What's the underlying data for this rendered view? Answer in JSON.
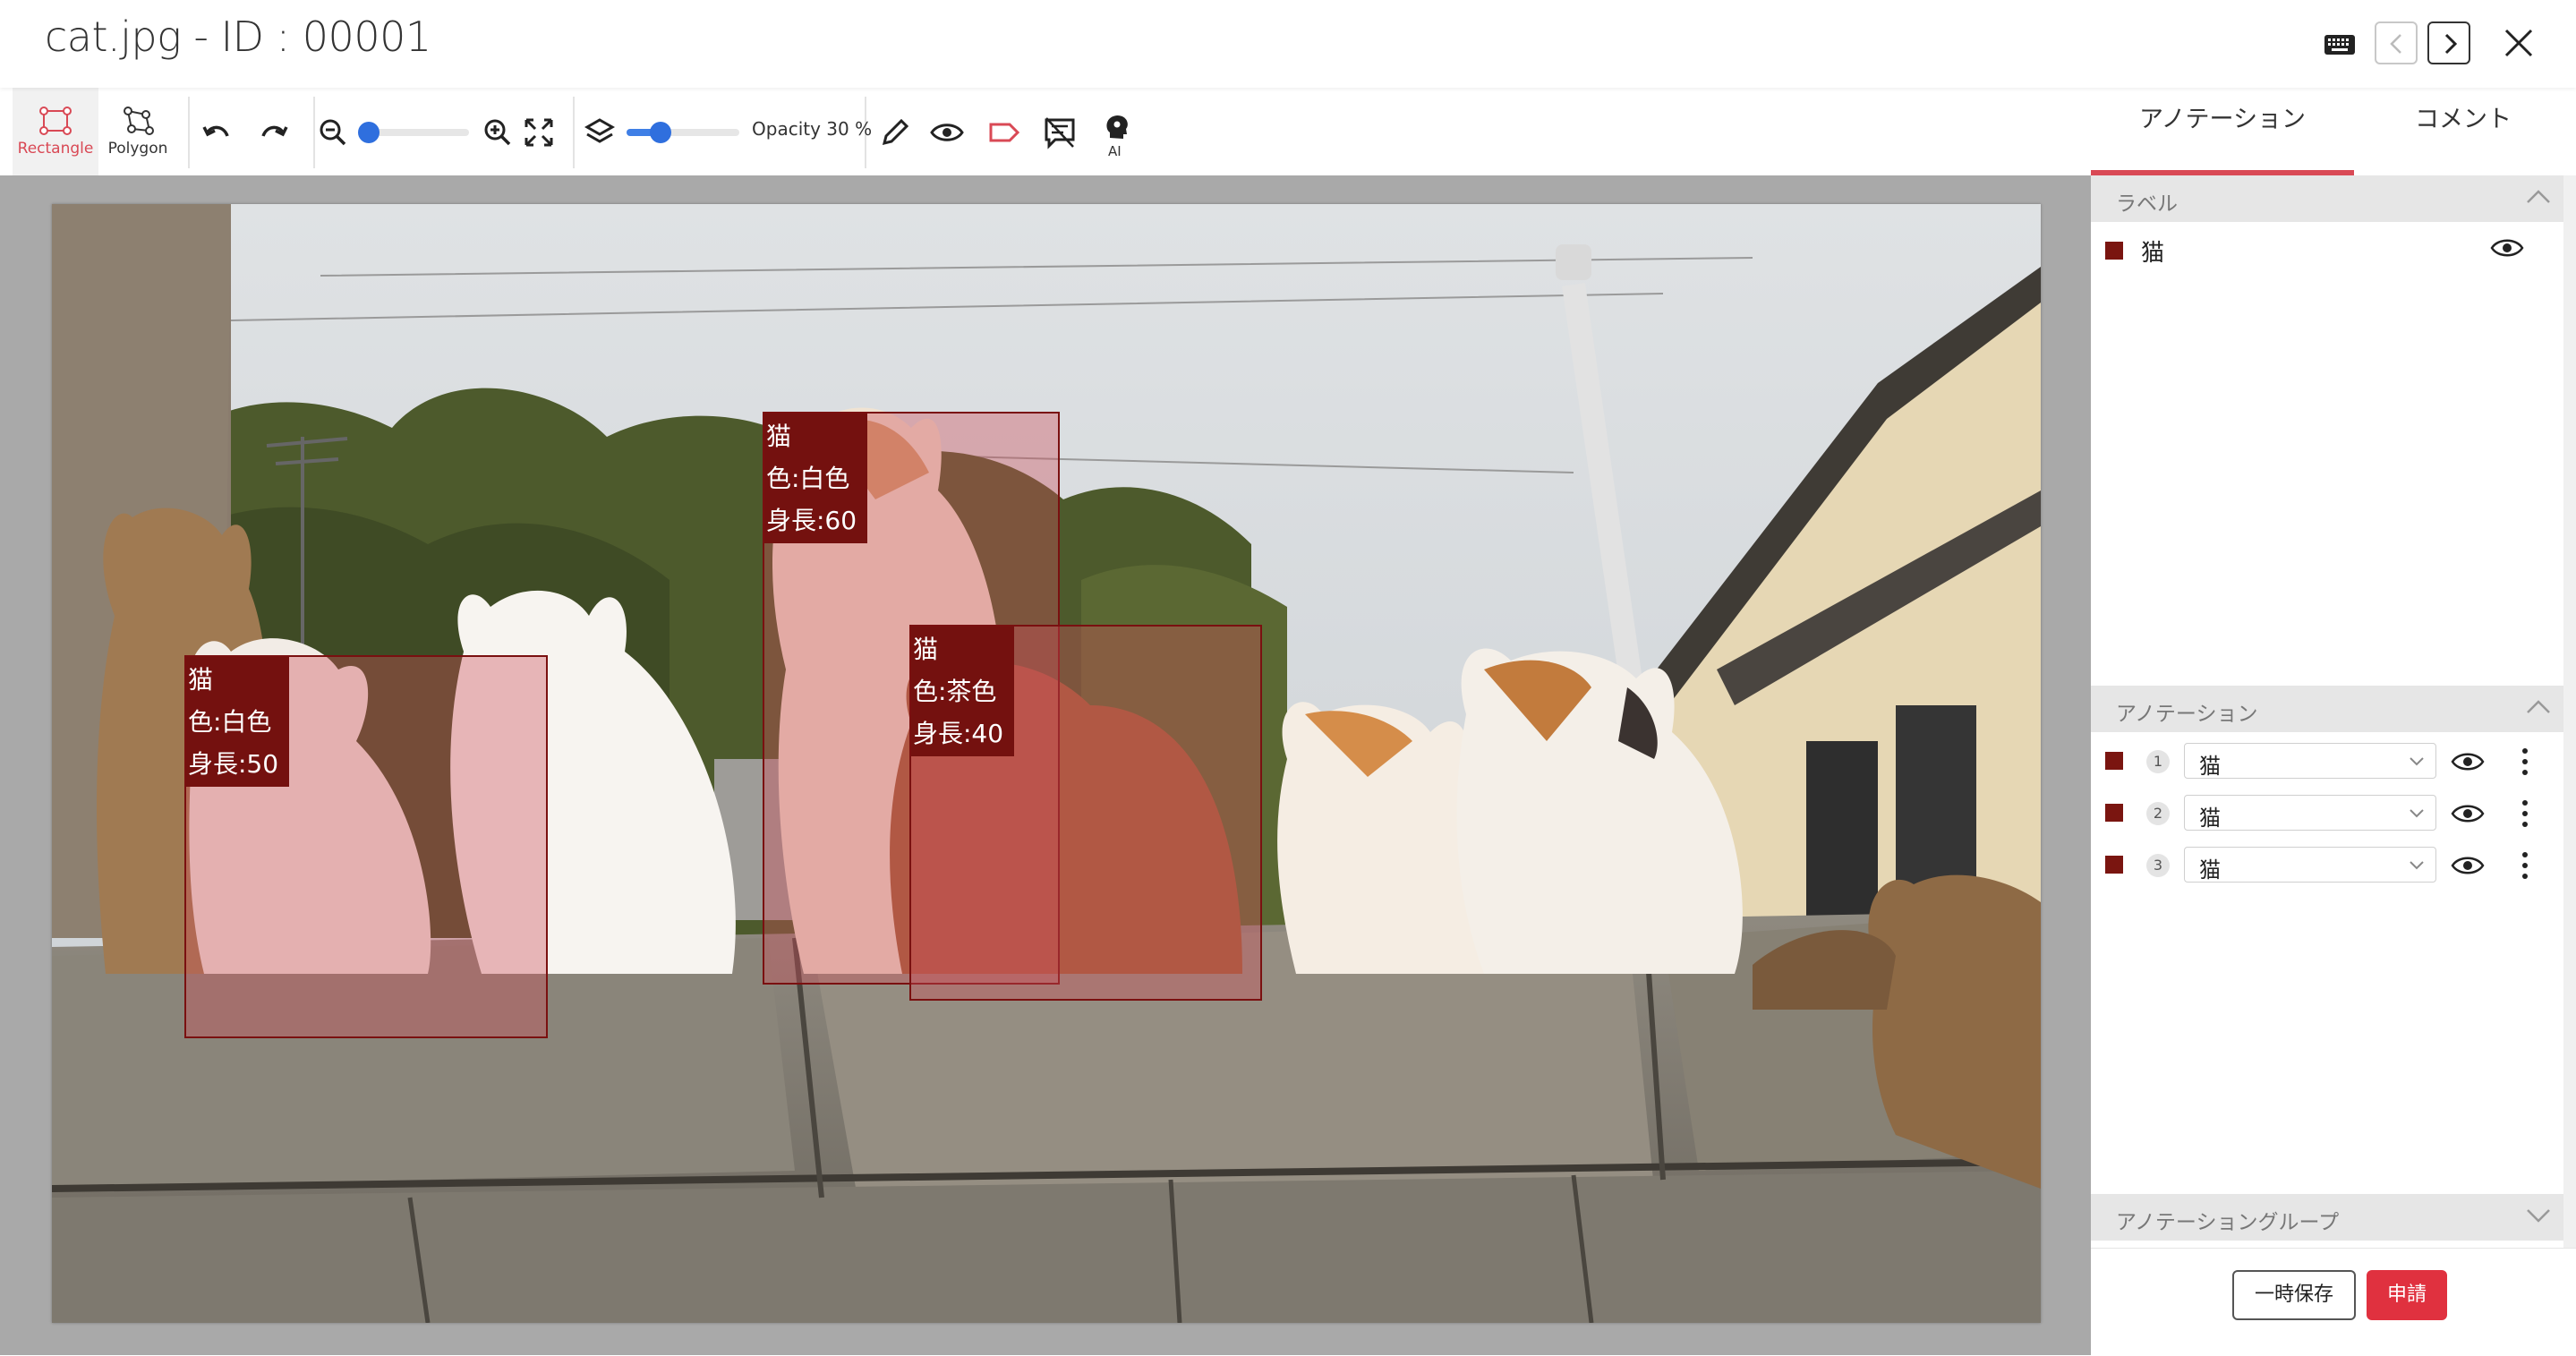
{
  "window": {
    "title": "cat.jpg - ID : 00001",
    "icons": [
      "keyboard-icon",
      "chevron-left-icon",
      "chevron-right-icon",
      "close-icon"
    ]
  },
  "toolbar": {
    "tools": [
      {
        "name": "rectangle",
        "label": "Rectangle",
        "active": true
      },
      {
        "name": "polygon",
        "label": "Polygon",
        "active": false
      }
    ],
    "zoom_level": 0.0,
    "opacity_label": "Opacity 30 %",
    "opacity_value": 30,
    "ai_label": "AI"
  },
  "canvas": {
    "image": "cat.jpg",
    "annotations": [
      {
        "id": 1,
        "label_line1": "猫",
        "label_line2": "色:白色",
        "label_line3": "身長:50"
      },
      {
        "id": 2,
        "label_line1": "猫",
        "label_line2": "色:白色",
        "label_line3": "身長:60"
      },
      {
        "id": 3,
        "label_line1": "猫",
        "label_line2": "色:茶色",
        "label_line3": "身長:40"
      }
    ]
  },
  "panel": {
    "tabs": [
      {
        "label": "アノテーション",
        "active": true
      },
      {
        "label": "コメント",
        "active": false
      }
    ],
    "labels_section": {
      "title": "ラベル",
      "items": [
        {
          "name": "猫",
          "color": "#7a1510"
        }
      ]
    },
    "annotations_section": {
      "title": "アノテーション",
      "rows": [
        {
          "num": "1",
          "value": "猫"
        },
        {
          "num": "2",
          "value": "猫"
        },
        {
          "num": "3",
          "value": "猫"
        }
      ]
    },
    "groups_section": {
      "title": "アノテーショングループ"
    },
    "save_label": "一時保存",
    "apply_label": "申請"
  },
  "colors": {
    "accent": "#d94955",
    "apply_button": "#e0313f",
    "annotation_box": "#7a1010",
    "slider": "#3f7fe6"
  }
}
